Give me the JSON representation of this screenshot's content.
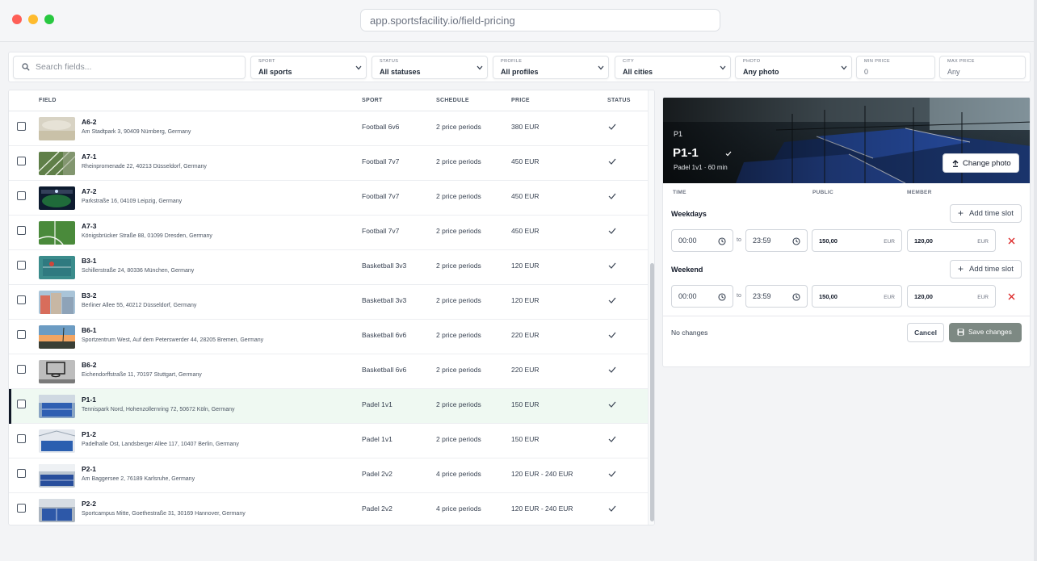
{
  "browser": {
    "url": "app.sportsfacility.io/field-pricing"
  },
  "filters": {
    "search_placeholder": "Search fields...",
    "sport": {
      "label": "SPORT",
      "value": "All sports"
    },
    "status": {
      "label": "STATUS",
      "value": "All statuses"
    },
    "profile": {
      "label": "PROFILE",
      "value": "All profiles"
    },
    "city": {
      "label": "CITY",
      "value": "All cities"
    },
    "photo": {
      "label": "PHOTO",
      "value": "Any photo"
    },
    "min_price": {
      "label": "MIN PRICE",
      "placeholder": "0"
    },
    "max_price": {
      "label": "MAX PRICE",
      "placeholder": "Any"
    }
  },
  "table": {
    "columns": [
      "FIELD",
      "SPORT",
      "SCHEDULE",
      "PRICE",
      "STATUS"
    ],
    "rows": [
      {
        "name": "A6-2",
        "address": "Am Stadtpark 3, 90409 Nürnberg, Germany",
        "sport": "Football 6v6",
        "schedule": "2 price periods",
        "price": "380 EUR",
        "thumb": "haze"
      },
      {
        "name": "A7-1",
        "address": "Rheinpromenade 22, 40213 Düsseldorf, Germany",
        "sport": "Football 7v7",
        "schedule": "2 price periods",
        "price": "450 EUR",
        "thumb": "turf-aerial"
      },
      {
        "name": "A7-2",
        "address": "Parkstraße 16, 04109 Leipzig, Germany",
        "sport": "Football 7v7",
        "schedule": "2 price periods",
        "price": "450 EUR",
        "thumb": "stadium-night"
      },
      {
        "name": "A7-3",
        "address": "Königsbrücker Straße 88, 01099 Dresden, Germany",
        "sport": "Football 7v7",
        "schedule": "2 price periods",
        "price": "450 EUR",
        "thumb": "grass-lines"
      },
      {
        "name": "B3-1",
        "address": "Schillerstraße 24, 80336 München, Germany",
        "sport": "Basketball 3v3",
        "schedule": "2 price periods",
        "price": "120 EUR",
        "thumb": "teal-court"
      },
      {
        "name": "B3-2",
        "address": "Berliner Allee 55, 40212 Düsseldorf, Germany",
        "sport": "Basketball 3v3",
        "schedule": "2 price periods",
        "price": "120 EUR",
        "thumb": "buildings"
      },
      {
        "name": "B6-1",
        "address": "Sportzentrum West, Auf dem Peterswerder 44, 28205 Bremen, Germany",
        "sport": "Basketball 6v6",
        "schedule": "2 price periods",
        "price": "220 EUR",
        "thumb": "sunset"
      },
      {
        "name": "B6-2",
        "address": "Eichendorffstraße 11, 70197 Stuttgart, Germany",
        "sport": "Basketball 6v6",
        "schedule": "2 price periods",
        "price": "220 EUR",
        "thumb": "bw-hoop"
      },
      {
        "name": "P1-1",
        "address": "Tennispark Nord, Hohenzollernring 72, 50672 Köln, Germany",
        "sport": "Padel 1v1",
        "schedule": "2 price periods",
        "price": "150 EUR",
        "thumb": "padel-blue",
        "selected": true
      },
      {
        "name": "P1-2",
        "address": "Padelhalle Ost, Landsberger Allee 117, 10407 Berlin, Germany",
        "sport": "Padel 1v1",
        "schedule": "2 price periods",
        "price": "150 EUR",
        "thumb": "padel-hall"
      },
      {
        "name": "P2-1",
        "address": "Am Baggersee 2, 76189 Karlsruhe, Germany",
        "sport": "Padel 2v2",
        "schedule": "4 price periods",
        "price": "120 EUR - 240 EUR",
        "thumb": "padel-indoor"
      },
      {
        "name": "P2-2",
        "address": "Sportcampus Mitte, Goethestraße 31, 30169 Hannover, Germany",
        "sport": "Padel 2v2",
        "schedule": "4 price periods",
        "price": "120 EUR - 240 EUR",
        "thumb": "padel-court"
      }
    ]
  },
  "detail": {
    "code": "P1",
    "title": "P1-1",
    "subtitle": "Padel 1v1 · 60 min",
    "change_photo_label": "Change photo",
    "headers": {
      "time": "TIME",
      "public": "PUBLIC",
      "member": "MEMBER"
    },
    "groups": [
      {
        "title": "Weekdays",
        "add_label": "Add time slot",
        "from": "00:00",
        "to_label": "to",
        "to": "23:59",
        "public": "150,00",
        "member": "120,00",
        "currency": "EUR"
      },
      {
        "title": "Weekend",
        "add_label": "Add time slot",
        "from": "00:00",
        "to_label": "to",
        "to": "23:59",
        "public": "150,00",
        "member": "120,00",
        "currency": "EUR"
      }
    ],
    "status_text": "No changes",
    "cancel_label": "Cancel",
    "save_label": "Save changes"
  },
  "colors": {
    "accent_selected_row": "#eff9f2",
    "check": "#374151",
    "delete": "#dc2626",
    "save_disabled": "#7d8983"
  }
}
